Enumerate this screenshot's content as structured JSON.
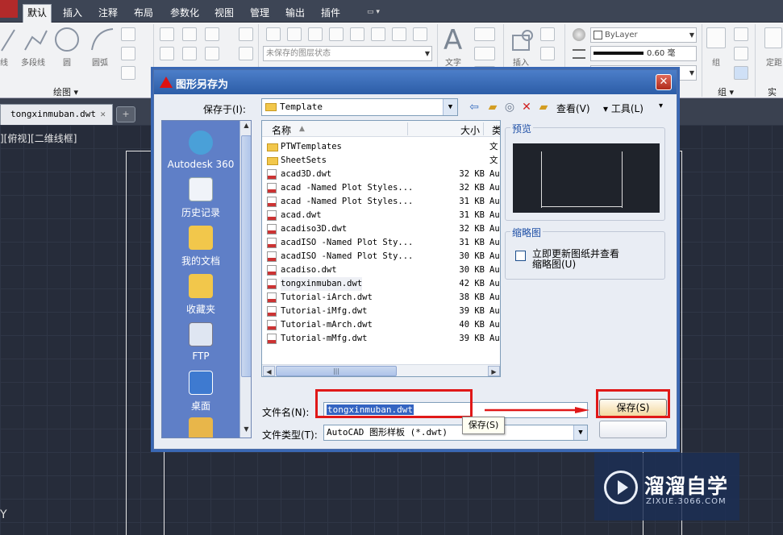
{
  "ribbon_tabs": [
    "默认",
    "插入",
    "注释",
    "布局",
    "参数化",
    "视图",
    "管理",
    "输出",
    "插件"
  ],
  "ribbon": {
    "draw_tools": [
      "线",
      "多段线",
      "圆",
      "圆弧"
    ],
    "draw_group": "绘图 ▾",
    "layer_state": "未保存的图层状态",
    "text_tool": "文字",
    "insert_tool": "插入",
    "bylayer": "ByLayer",
    "lineweight": "0.60 毫",
    "group_tool": "组",
    "group_title": "组 ▾",
    "fixed_label": "定距",
    "practical": "实用"
  },
  "doc_tab": {
    "name": "tongxinmuban.dwt",
    "close": "✕"
  },
  "view_label": "][俯视][二维线框]",
  "ucs_y": "Y",
  "dialog": {
    "title": "图形另存为",
    "close": "✕",
    "save_in_label": "保存于(I):",
    "save_in_value": "Template",
    "view_menu": "查看(V)",
    "tools_menu": "▾ 工具(L)",
    "tools_arrow": "▾",
    "places": [
      {
        "label": "Autodesk 360",
        "color": "#4aa0d8"
      },
      {
        "label": "历史记录",
        "color": "#f0f3f9"
      },
      {
        "label": "我的文档",
        "color": "#f2c74b"
      },
      {
        "label": "收藏夹",
        "color": "#f2c74b"
      },
      {
        "label": "FTP",
        "color": "#dfe6f2"
      },
      {
        "label": "桌面",
        "color": "#3e7ad0"
      },
      {
        "label": "",
        "color": "#e8b64a"
      }
    ],
    "list_headers": {
      "name": "名称",
      "size": "大小",
      "type": "类"
    },
    "files": [
      {
        "name": "PTWTemplates",
        "size": "",
        "type": "文",
        "kind": "folder"
      },
      {
        "name": "SheetSets",
        "size": "",
        "type": "文",
        "kind": "folder"
      },
      {
        "name": "acad3D.dwt",
        "size": "32 KB",
        "type": "Au",
        "kind": "file"
      },
      {
        "name": "acad -Named Plot Styles...",
        "size": "32 KB",
        "type": "Au",
        "kind": "file"
      },
      {
        "name": "acad -Named Plot Styles...",
        "size": "31 KB",
        "type": "Au",
        "kind": "file"
      },
      {
        "name": "acad.dwt",
        "size": "31 KB",
        "type": "Au",
        "kind": "file"
      },
      {
        "name": "acadiso3D.dwt",
        "size": "32 KB",
        "type": "Au",
        "kind": "file"
      },
      {
        "name": "acadISO -Named Plot Sty...",
        "size": "31 KB",
        "type": "Au",
        "kind": "file"
      },
      {
        "name": "acadISO -Named Plot Sty...",
        "size": "30 KB",
        "type": "Au",
        "kind": "file"
      },
      {
        "name": "acadiso.dwt",
        "size": "30 KB",
        "type": "Au",
        "kind": "file"
      },
      {
        "name": "tongxinmuban.dwt",
        "size": "42 KB",
        "type": "Au",
        "kind": "file"
      },
      {
        "name": "Tutorial-iArch.dwt",
        "size": "38 KB",
        "type": "Au",
        "kind": "file"
      },
      {
        "name": "Tutorial-iMfg.dwt",
        "size": "39 KB",
        "type": "Au",
        "kind": "file"
      },
      {
        "name": "Tutorial-mArch.dwt",
        "size": "40 KB",
        "type": "Au",
        "kind": "file"
      },
      {
        "name": "Tutorial-mMfg.dwt",
        "size": "39 KB",
        "type": "Au",
        "kind": "file"
      }
    ],
    "preview_title": "预览",
    "thumbnail_title": "缩略图",
    "thumbnail_option": "立即更新图纸并查看",
    "thumbnail_option2": "缩略图(U)",
    "filename_label": "文件名(N):",
    "filename_value": "tongxinmuban.dwt",
    "filetype_label": "文件类型(T):",
    "filetype_value": "AutoCAD 图形样板 (*.dwt)",
    "save_button": "保存(S)",
    "tooltip": "保存(S)"
  },
  "watermark": {
    "cn": "溜溜自学",
    "en": "ZIXUE.3066.COM"
  }
}
